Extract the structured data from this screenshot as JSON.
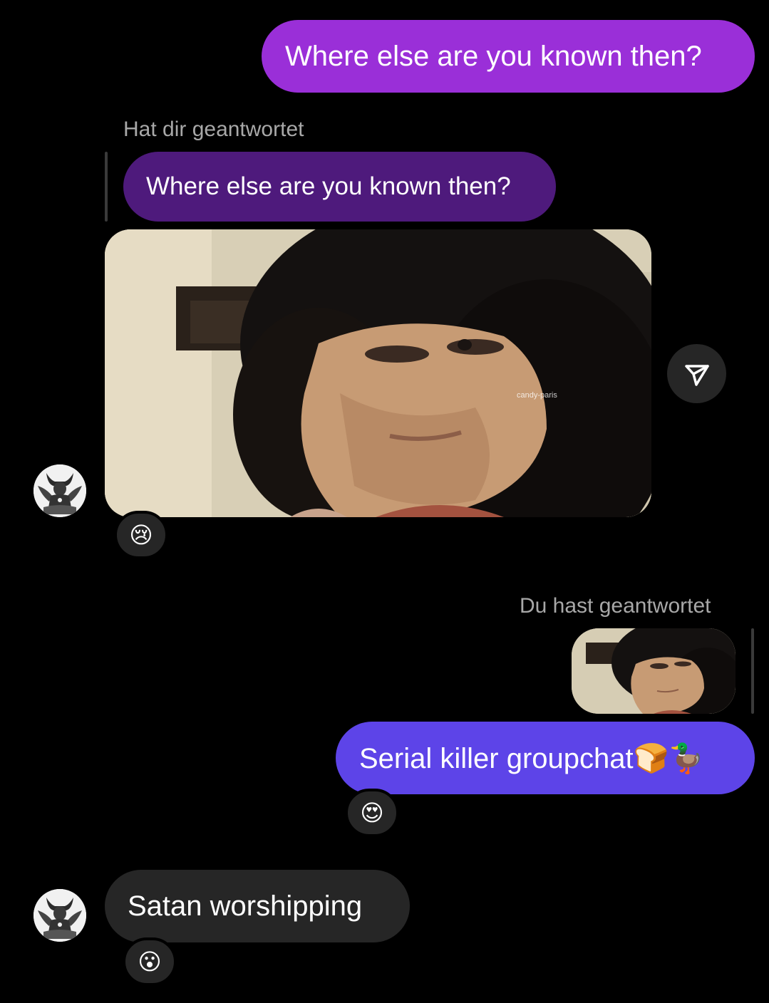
{
  "conversation": {
    "messages": [
      {
        "direction": "outgoing",
        "text": "Where else are you known then?",
        "color": "#9a2fd8"
      },
      {
        "direction": "incoming",
        "reply_label": "Hat dir geantwortet",
        "quoted_text": "Where else are you known then?",
        "media_watermark": "candy-paris",
        "share_icon": "send-icon",
        "reaction": "😢"
      },
      {
        "direction": "outgoing",
        "reply_label": "Du hast geantwortet",
        "quoted_media": "thumbnail-image",
        "text": "Serial killer groupchat🍞🦆",
        "color": "#5d44e8",
        "reaction": "😍"
      },
      {
        "direction": "incoming",
        "text": "Satan worshipping",
        "color": "#262626",
        "reaction": "😮"
      }
    ]
  }
}
